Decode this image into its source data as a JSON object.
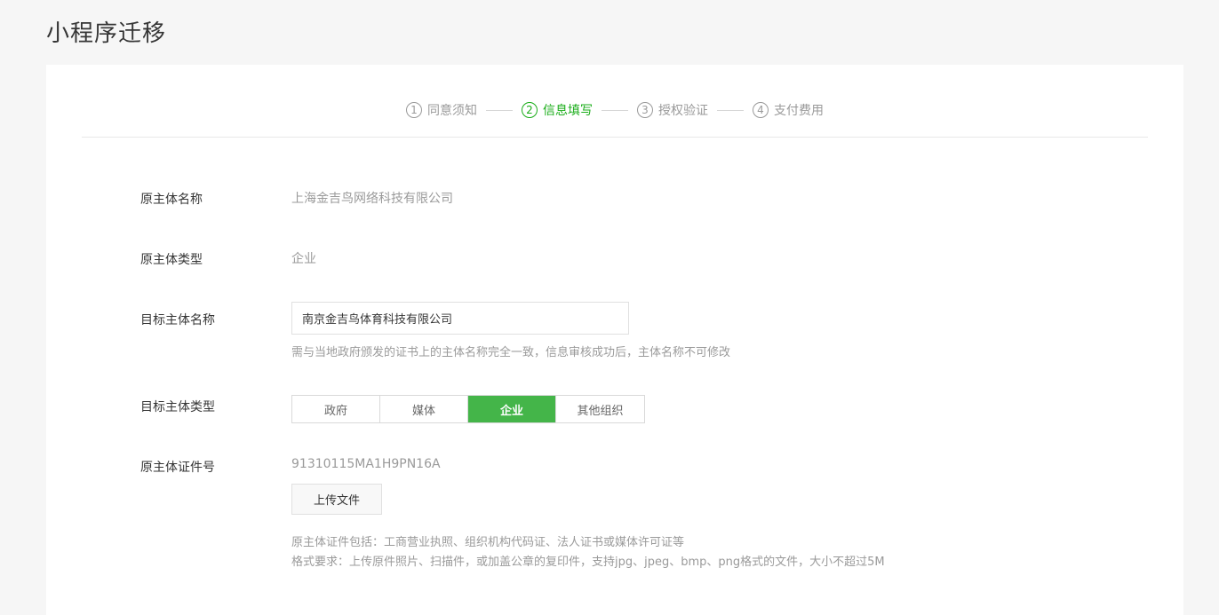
{
  "page": {
    "title": "小程序迁移"
  },
  "steps": [
    {
      "num": "1",
      "label": "同意须知",
      "active": false
    },
    {
      "num": "2",
      "label": "信息填写",
      "active": true
    },
    {
      "num": "3",
      "label": "授权验证",
      "active": false
    },
    {
      "num": "4",
      "label": "支付费用",
      "active": false
    }
  ],
  "form": {
    "original_name": {
      "label": "原主体名称",
      "value": "上海金吉鸟网络科技有限公司"
    },
    "original_type": {
      "label": "原主体类型",
      "value": "企业"
    },
    "target_name": {
      "label": "目标主体名称",
      "value": "南京金吉鸟体育科技有限公司",
      "hint": "需与当地政府颁发的证书上的主体名称完全一致，信息审核成功后，主体名称不可修改"
    },
    "target_type": {
      "label": "目标主体类型",
      "options": [
        "政府",
        "媒体",
        "企业",
        "其他组织"
      ],
      "selected": "企业"
    },
    "original_cert": {
      "label": "原主体证件号",
      "value": "91310115MA1H9PN16A",
      "upload_label": "上传文件",
      "hint_line1": "原主体证件包括：工商营业执照、组织机构代码证、法人证书或媒体许可证等",
      "hint_line2": "格式要求：上传原件照片、扫描件，或加盖公章的复印件，支持jpg、jpeg、bmp、png格式的文件，大小不超过5M"
    }
  },
  "colors": {
    "accent": "#1aad19",
    "segment_active": "#44b549"
  }
}
